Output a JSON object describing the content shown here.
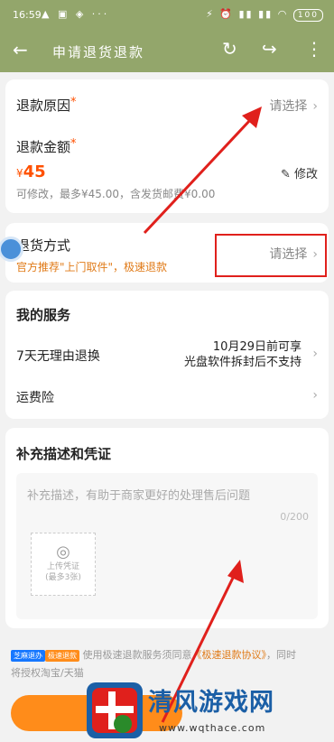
{
  "statusbar": {
    "time": "16:59",
    "left_icons": "▲ ▣ ◈ ···",
    "right_icons": "⚡ ⏰ ▮▮ ▮▮ ◠",
    "battery": "100"
  },
  "navbar": {
    "back": "←",
    "title": "申请退货退款",
    "refresh": "↻",
    "share": "↪",
    "more": "⋮"
  },
  "refund_reason": {
    "label": "退款原因",
    "required_mark": "*",
    "placeholder": "请选择",
    "chevron": "›"
  },
  "refund_amount": {
    "label": "退款金额",
    "required_mark": "*",
    "currency": "¥",
    "amount": "45",
    "note": "可修改，最多¥45.00，含发货邮费¥0.00",
    "edit_label": "修改",
    "edit_icon": "✎"
  },
  "return_method": {
    "label": "退货方式",
    "placeholder": "请选择",
    "chevron": "›",
    "recommend": "官方推荐\"上门取件\"，极速退款"
  },
  "services": {
    "title": "我的服务",
    "items": [
      {
        "label": "7天无理由退换",
        "value_line1": "10月29日前可享",
        "value_line2": "光盘软件拆封后不支持",
        "chevron": "›"
      },
      {
        "label": "运费险",
        "chevron": "›"
      }
    ]
  },
  "evidence": {
    "title": "补充描述和凭证",
    "placeholder": "补充描述，有助于商家更好的处理售后问题",
    "counter": "0/200",
    "upload_line1": "上传凭证",
    "upload_line2": "(最多3张)"
  },
  "bottom": {
    "badge1": "芝麻退办",
    "badge2": "极速退款",
    "text_prefix": "使用极速退款服务须同意",
    "agreement": "《极速退款协议》",
    "text_suffix": "，同时",
    "line2": "将授权淘宝/天猫"
  },
  "watermark": {
    "text": "清风游戏网",
    "url": "www.wqthace.com"
  },
  "colors": {
    "header": "#93a66b",
    "accent": "#ff5000",
    "annotation": "#e0201c"
  }
}
